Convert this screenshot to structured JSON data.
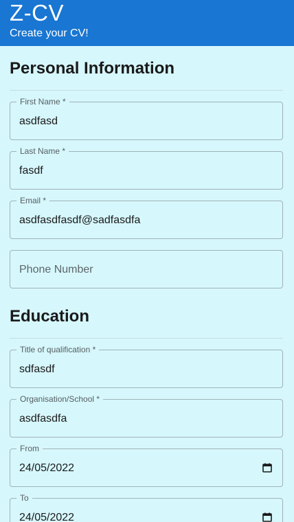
{
  "app": {
    "title": "Z-CV",
    "subtitle": "Create your CV!"
  },
  "personal": {
    "heading": "Personal Information",
    "first_name": {
      "label": "First Name *",
      "value": "asdfasd"
    },
    "last_name": {
      "label": "Last Name *",
      "value": "fasdf"
    },
    "email": {
      "label": "Email *",
      "value": "asdfasdfasdf@sadfasdfa"
    },
    "phone": {
      "placeholder": "Phone Number",
      "value": ""
    }
  },
  "education": {
    "heading": "Education",
    "qualification": {
      "label": "Title of qualification *",
      "value": "sdfasdf"
    },
    "organisation": {
      "label": "Organisation/School *",
      "value": "asdfasdfa"
    },
    "from": {
      "label": "From",
      "value": "24/05/2022",
      "icon": "calendar-icon"
    },
    "to": {
      "label": "To",
      "value": "24/05/2022",
      "icon": "calendar-icon"
    }
  },
  "colors": {
    "app_bar": "#1976d2",
    "background": "#d6f7fc",
    "outline": "#9fb3b7"
  }
}
